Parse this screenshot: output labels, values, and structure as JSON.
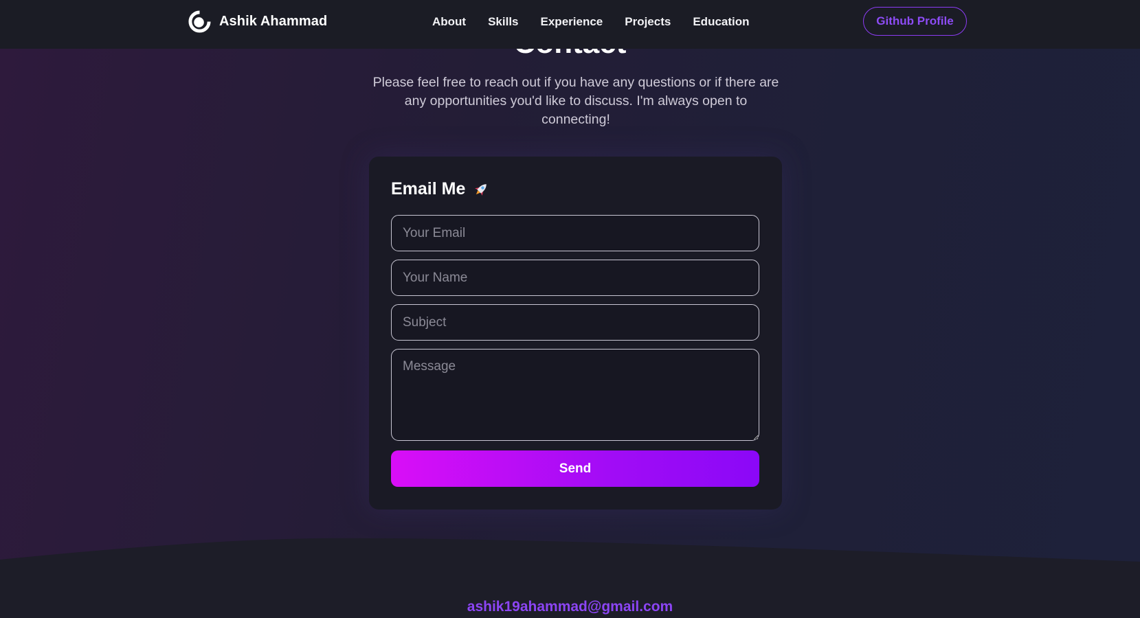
{
  "navbar": {
    "brand_name": "Ashik Ahammad",
    "links": [
      {
        "label": "About"
      },
      {
        "label": "Skills"
      },
      {
        "label": "Experience"
      },
      {
        "label": "Projects"
      },
      {
        "label": "Education"
      }
    ],
    "github_label": "Github Profile"
  },
  "contact": {
    "heading": "Contact",
    "description": "Please feel free to reach out if you have any questions or if there are any opportunities you'd like to discuss. I'm always open to connecting!"
  },
  "form": {
    "title": "Email Me",
    "title_icon": "rocket-icon",
    "email_placeholder": "Your Email",
    "name_placeholder": "Your Name",
    "subject_placeholder": "Subject",
    "message_placeholder": "Message",
    "email_value": "",
    "name_value": "",
    "subject_value": "",
    "message_value": "",
    "send_label": "Send"
  },
  "footer": {
    "email": "ashik19ahammad@gmail.com"
  },
  "colors": {
    "accent": "#8d3cf5",
    "send_gradient_start": "#d90ef7",
    "send_gradient_end": "#8b08f7",
    "card_bg": "#1a1a25",
    "navbar_bg": "#1b1c25"
  }
}
